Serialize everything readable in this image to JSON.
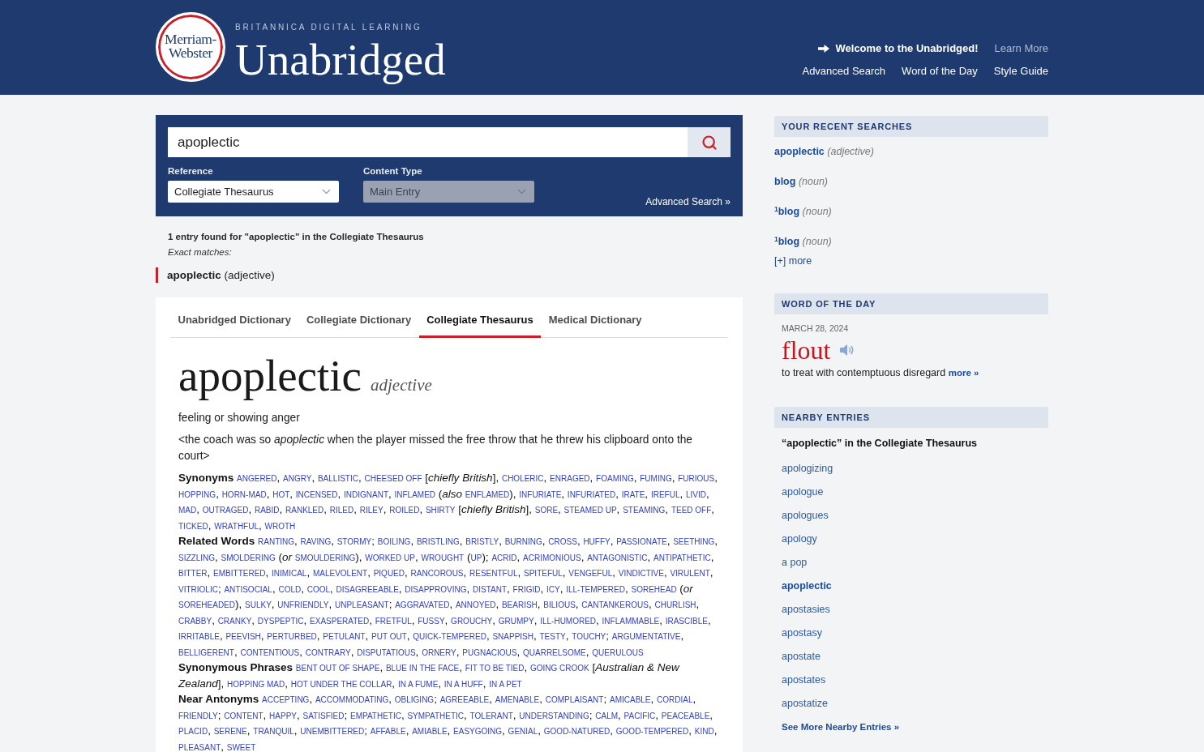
{
  "header": {
    "logo": "Merriam-Webster",
    "tagline": "BRITANNICA DIGITAL LEARNING",
    "title": "Unabridged",
    "welcome": "Welcome to the Unabridged!",
    "learn_more": "Learn More",
    "nav": [
      "Advanced Search",
      "Word of the Day",
      "Style Guide"
    ]
  },
  "search": {
    "value": "apoplectic",
    "selects": [
      {
        "label": "Reference",
        "value": "Collegiate Thesaurus",
        "disabled": false
      },
      {
        "label": "Content Type",
        "value": "Main Entry",
        "disabled": true
      }
    ],
    "advanced_link": "Advanced Search »"
  },
  "results": {
    "summary": "1 entry found for \"apoplectic\" in the Collegiate Thesaurus",
    "exact_label": "Exact matches:",
    "matches": [
      "**apoplectic** (adjective)"
    ]
  },
  "tabs": [
    {
      "label": "Unabridged Dictionary",
      "selected": false
    },
    {
      "label": "Collegiate Dictionary",
      "selected": false
    },
    {
      "label": "Collegiate Thesaurus",
      "selected": true
    },
    {
      "label": "Medical Dictionary",
      "selected": false
    }
  ],
  "entry": {
    "headword": "apoplectic",
    "pos": "adjective",
    "definition": "feeling or showing anger",
    "example": "<the coach was so *apoplectic* when the player missed the free throw that he threw his clipboard onto the court>",
    "word_groups": [
      {
        "label": "Synonyms",
        "items": [
          {
            "kind": "link",
            "text": "ANGERED",
            "sep": ", "
          },
          {
            "kind": "link",
            "text": "ANGRY",
            "sep": ", "
          },
          {
            "kind": "link",
            "text": "BALLISTIC",
            "sep": ", "
          },
          {
            "kind": "link",
            "text": "CHEESED OFF",
            "sep": " ["
          },
          {
            "kind": "note",
            "text": "chiefly British",
            "sep": "], "
          },
          {
            "kind": "link",
            "text": "CHOLERIC",
            "sep": ", "
          },
          {
            "kind": "link",
            "text": "ENRAGED",
            "sep": ", "
          },
          {
            "kind": "link",
            "text": "FOAMING",
            "sep": ", "
          },
          {
            "kind": "link",
            "text": "FUMING",
            "sep": ", "
          },
          {
            "kind": "link",
            "text": "FURIOUS",
            "sep": ", "
          },
          {
            "kind": "link",
            "text": "HOPPING",
            "sep": ", "
          },
          {
            "kind": "link",
            "text": "HORN-MAD",
            "sep": ", "
          },
          {
            "kind": "link",
            "text": "HOT",
            "sep": ", "
          },
          {
            "kind": "link",
            "text": "INCENSED",
            "sep": ", "
          },
          {
            "kind": "link",
            "text": "INDIGNANT",
            "sep": ", "
          },
          {
            "kind": "link",
            "text": "INFLAMED",
            "sep": " ("
          },
          {
            "kind": "note",
            "text": "also"
          },
          {
            "kind": "link",
            "text": "ENFLAMED",
            "sep": "), "
          },
          {
            "kind": "link",
            "text": "INFURIATE",
            "sep": ", "
          },
          {
            "kind": "link",
            "text": "INFURIATED",
            "sep": ", "
          },
          {
            "kind": "link",
            "text": "IRATE",
            "sep": ", "
          },
          {
            "kind": "link",
            "text": "IREFUL",
            "sep": ", "
          },
          {
            "kind": "link",
            "text": "LIVID",
            "sep": ", "
          },
          {
            "kind": "link",
            "text": "MAD",
            "sep": ", "
          },
          {
            "kind": "link",
            "text": "OUTRAGED",
            "sep": ", "
          },
          {
            "kind": "link",
            "text": "RABID",
            "sep": ", "
          },
          {
            "kind": "link",
            "text": "RANKLED",
            "sep": ", "
          },
          {
            "kind": "link",
            "text": "RILED",
            "sep": ", "
          },
          {
            "kind": "link",
            "text": "RILEY",
            "sep": ", "
          },
          {
            "kind": "link",
            "text": "ROILED",
            "sep": ", "
          },
          {
            "kind": "link",
            "text": "SHIRTY",
            "sep": " ["
          },
          {
            "kind": "note",
            "text": "chiefly British",
            "sep": "], "
          },
          {
            "kind": "link",
            "text": "SORE",
            "sep": ", "
          },
          {
            "kind": "link",
            "text": "STEAMED UP",
            "sep": ", "
          },
          {
            "kind": "link",
            "text": "STEAMING",
            "sep": ", "
          },
          {
            "kind": "link",
            "text": "TEED OFF",
            "sep": ", "
          },
          {
            "kind": "link",
            "text": "TICKED",
            "sep": ", "
          },
          {
            "kind": "link",
            "text": "WRATHFUL",
            "sep": ", "
          },
          {
            "kind": "link",
            "text": "WROTH"
          }
        ]
      },
      {
        "label": "Related Words",
        "items": [
          {
            "kind": "link",
            "text": "RANTING",
            "sep": ", "
          },
          {
            "kind": "link",
            "text": "RAVING",
            "sep": ", "
          },
          {
            "kind": "link",
            "text": "STORMY",
            "sep": "; "
          },
          {
            "kind": "link",
            "text": "BOILING",
            "sep": ", "
          },
          {
            "kind": "link",
            "text": "BRISTLING",
            "sep": ", "
          },
          {
            "kind": "link",
            "text": "BRISTLY",
            "sep": ", "
          },
          {
            "kind": "link",
            "text": "BURNING",
            "sep": ", "
          },
          {
            "kind": "link",
            "text": "CROSS",
            "sep": ", "
          },
          {
            "kind": "link",
            "text": "HUFFY",
            "sep": ", "
          },
          {
            "kind": "link",
            "text": "PASSIONATE",
            "sep": ", "
          },
          {
            "kind": "link",
            "text": "SEETHING",
            "sep": ", "
          },
          {
            "kind": "link",
            "text": "SIZZLING",
            "sep": ", "
          },
          {
            "kind": "link",
            "text": "SMOLDERING",
            "sep": " ("
          },
          {
            "kind": "note",
            "text": "or"
          },
          {
            "kind": "link",
            "text": "SMOULDERING",
            "sep": "), "
          },
          {
            "kind": "link",
            "text": "WORKED UP",
            "sep": ", "
          },
          {
            "kind": "link",
            "text": "WROUGHT",
            "sep": " ("
          },
          {
            "kind": "link",
            "text": "UP",
            "sep": "); "
          },
          {
            "kind": "link",
            "text": "ACRID",
            "sep": ", "
          },
          {
            "kind": "link",
            "text": "ACRIMONIOUS",
            "sep": ", "
          },
          {
            "kind": "link",
            "text": "ANTAGONISTIC",
            "sep": ", "
          },
          {
            "kind": "link",
            "text": "ANTIPATHETIC",
            "sep": ", "
          },
          {
            "kind": "link",
            "text": "BITTER",
            "sep": ", "
          },
          {
            "kind": "link",
            "text": "EMBITTERED",
            "sep": ", "
          },
          {
            "kind": "link",
            "text": "INIMICAL",
            "sep": ", "
          },
          {
            "kind": "link",
            "text": "MALEVOLENT",
            "sep": ", "
          },
          {
            "kind": "link",
            "text": "PIQUED",
            "sep": ", "
          },
          {
            "kind": "link",
            "text": "RANCOROUS",
            "sep": ", "
          },
          {
            "kind": "link",
            "text": "RESENTFUL",
            "sep": ", "
          },
          {
            "kind": "link",
            "text": "SPITEFUL",
            "sep": ", "
          },
          {
            "kind": "link",
            "text": "VENGEFUL",
            "sep": ", "
          },
          {
            "kind": "link",
            "text": "VINDICTIVE",
            "sep": ", "
          },
          {
            "kind": "link",
            "text": "VIRULENT",
            "sep": ", "
          },
          {
            "kind": "link",
            "text": "VITRIOLIC",
            "sep": "; "
          },
          {
            "kind": "link",
            "text": "ANTISOCIAL",
            "sep": ", "
          },
          {
            "kind": "link",
            "text": "COLD",
            "sep": ", "
          },
          {
            "kind": "link",
            "text": "COOL",
            "sep": ", "
          },
          {
            "kind": "link",
            "text": "DISAGREEABLE",
            "sep": ", "
          },
          {
            "kind": "link",
            "text": "DISAPPROVING",
            "sep": ", "
          },
          {
            "kind": "link",
            "text": "DISTANT",
            "sep": ", "
          },
          {
            "kind": "link",
            "text": "FRIGID",
            "sep": ", "
          },
          {
            "kind": "link",
            "text": "ICY",
            "sep": ", "
          },
          {
            "kind": "link",
            "text": "ILL-TEMPERED",
            "sep": ", "
          },
          {
            "kind": "link",
            "text": "SOREHEAD",
            "sep": " ("
          },
          {
            "kind": "note",
            "text": "or"
          },
          {
            "kind": "link",
            "text": "SOREHEADED",
            "sep": "), "
          },
          {
            "kind": "link",
            "text": "SULKY",
            "sep": ", "
          },
          {
            "kind": "link",
            "text": "UNFRIENDLY",
            "sep": ", "
          },
          {
            "kind": "link",
            "text": "UNPLEASANT",
            "sep": "; "
          },
          {
            "kind": "link",
            "text": "AGGRAVATED",
            "sep": ", "
          },
          {
            "kind": "link",
            "text": "ANNOYED",
            "sep": ", "
          },
          {
            "kind": "link",
            "text": "BEARISH",
            "sep": ", "
          },
          {
            "kind": "link",
            "text": "BILIOUS",
            "sep": ", "
          },
          {
            "kind": "link",
            "text": "CANTANKEROUS",
            "sep": ", "
          },
          {
            "kind": "link",
            "text": "CHURLISH",
            "sep": ", "
          },
          {
            "kind": "link",
            "text": "CRABBY",
            "sep": ", "
          },
          {
            "kind": "link",
            "text": "CRANKY",
            "sep": ", "
          },
          {
            "kind": "link",
            "text": "DYSPEPTIC",
            "sep": ", "
          },
          {
            "kind": "link",
            "text": "EXASPERATED",
            "sep": ", "
          },
          {
            "kind": "link",
            "text": "FRETFUL",
            "sep": ", "
          },
          {
            "kind": "link",
            "text": "FUSSY",
            "sep": ", "
          },
          {
            "kind": "link",
            "text": "GROUCHY",
            "sep": ", "
          },
          {
            "kind": "link",
            "text": "GRUMPY",
            "sep": ", "
          },
          {
            "kind": "link",
            "text": "ILL-HUMORED",
            "sep": ", "
          },
          {
            "kind": "link",
            "text": "INFLAMMABLE",
            "sep": ", "
          },
          {
            "kind": "link",
            "text": "IRASCIBLE",
            "sep": ", "
          },
          {
            "kind": "link",
            "text": "IRRITABLE",
            "sep": ", "
          },
          {
            "kind": "link",
            "text": "PEEVISH",
            "sep": ", "
          },
          {
            "kind": "link",
            "text": "PERTURBED",
            "sep": ", "
          },
          {
            "kind": "link",
            "text": "PETULANT",
            "sep": ", "
          },
          {
            "kind": "link",
            "text": "PUT OUT",
            "sep": ", "
          },
          {
            "kind": "link",
            "text": "QUICK-TEMPERED",
            "sep": ", "
          },
          {
            "kind": "link",
            "text": "SNAPPISH",
            "sep": ", "
          },
          {
            "kind": "link",
            "text": "TESTY",
            "sep": ", "
          },
          {
            "kind": "link",
            "text": "TOUCHY",
            "sep": "; "
          },
          {
            "kind": "link",
            "text": "ARGUMENTATIVE",
            "sep": ", "
          },
          {
            "kind": "link",
            "text": "BELLIGERENT",
            "sep": ", "
          },
          {
            "kind": "link",
            "text": "CONTENTIOUS",
            "sep": ", "
          },
          {
            "kind": "link",
            "text": "CONTRARY",
            "sep": ", "
          },
          {
            "kind": "link",
            "text": "DISPUTATIOUS",
            "sep": ", "
          },
          {
            "kind": "link",
            "text": "ORNERY",
            "sep": ", "
          },
          {
            "kind": "link",
            "text": "PUGNACIOUS",
            "sep": ", "
          },
          {
            "kind": "link",
            "text": "QUARRELSOME",
            "sep": ", "
          },
          {
            "kind": "link",
            "text": "QUERULOUS"
          }
        ]
      },
      {
        "label": "Synonymous Phrases",
        "items": [
          {
            "kind": "link",
            "text": "BENT OUT OF SHAPE",
            "sep": ", "
          },
          {
            "kind": "link",
            "text": "BLUE IN THE FACE",
            "sep": ", "
          },
          {
            "kind": "link",
            "text": "FIT TO BE TIED",
            "sep": ", "
          },
          {
            "kind": "link",
            "text": "GOING CROOK",
            "sep": " ["
          },
          {
            "kind": "note",
            "text": "Australian & New Zealand",
            "sep": "], "
          },
          {
            "kind": "link",
            "text": "HOPPING MAD",
            "sep": ", "
          },
          {
            "kind": "link",
            "text": "HOT UNDER THE COLLAR",
            "sep": ", "
          },
          {
            "kind": "link",
            "text": "IN A FUME",
            "sep": ", "
          },
          {
            "kind": "link",
            "text": "IN A HUFF",
            "sep": ", "
          },
          {
            "kind": "link",
            "text": "IN A PET"
          }
        ]
      },
      {
        "label": "Near Antonyms",
        "items": [
          {
            "kind": "link",
            "text": "ACCEPTING",
            "sep": ", "
          },
          {
            "kind": "link",
            "text": "ACCOMMODATING",
            "sep": ", "
          },
          {
            "kind": "link",
            "text": "OBLIGING",
            "sep": "; "
          },
          {
            "kind": "link",
            "text": "AGREEABLE",
            "sep": ", "
          },
          {
            "kind": "link",
            "text": "AMENABLE",
            "sep": ", "
          },
          {
            "kind": "link",
            "text": "COMPLAISANT",
            "sep": "; "
          },
          {
            "kind": "link",
            "text": "AMICABLE",
            "sep": ", "
          },
          {
            "kind": "link",
            "text": "CORDIAL",
            "sep": ", "
          },
          {
            "kind": "link",
            "text": "FRIENDLY",
            "sep": "; "
          },
          {
            "kind": "link",
            "text": "CONTENT",
            "sep": ", "
          },
          {
            "kind": "link",
            "text": "HAPPY",
            "sep": ", "
          },
          {
            "kind": "link",
            "text": "SATISFIED",
            "sep": "; "
          },
          {
            "kind": "link",
            "text": "EMPATHETIC",
            "sep": ", "
          },
          {
            "kind": "link",
            "text": "SYMPATHETIC",
            "sep": ", "
          },
          {
            "kind": "link",
            "text": "TOLERANT",
            "sep": ", "
          },
          {
            "kind": "link",
            "text": "UNDERSTANDING",
            "sep": "; "
          },
          {
            "kind": "link",
            "text": "CALM",
            "sep": ", "
          },
          {
            "kind": "link",
            "text": "PACIFIC",
            "sep": ", "
          },
          {
            "kind": "link",
            "text": "PEACEABLE",
            "sep": ", "
          },
          {
            "kind": "link",
            "text": "PLACID",
            "sep": ", "
          },
          {
            "kind": "link",
            "text": "SERENE",
            "sep": ", "
          },
          {
            "kind": "link",
            "text": "TRANQUIL",
            "sep": ", "
          },
          {
            "kind": "link",
            "text": "UNEMBITTERED",
            "sep": "; "
          },
          {
            "kind": "link",
            "text": "AFFABLE",
            "sep": ", "
          },
          {
            "kind": "link",
            "text": "AMIABLE",
            "sep": ", "
          },
          {
            "kind": "link",
            "text": "EASYGOING",
            "sep": ", "
          },
          {
            "kind": "link",
            "text": "GENIAL",
            "sep": ", "
          },
          {
            "kind": "link",
            "text": "GOOD-NATURED",
            "sep": ", "
          },
          {
            "kind": "link",
            "text": "GOOD-TEMPERED",
            "sep": ", "
          },
          {
            "kind": "link",
            "text": "KIND",
            "sep": ", "
          },
          {
            "kind": "link",
            "text": "PLEASANT",
            "sep": ", "
          },
          {
            "kind": "link",
            "text": "SWEET"
          }
        ]
      }
    ]
  },
  "sidebar": {
    "recent": {
      "title": "YOUR RECENT SEARCHES",
      "items": [
        {
          "word": "apoplectic",
          "pos": "(adjective)"
        },
        {
          "word": "blog",
          "pos": "(noun)"
        },
        {
          "word": "$^{1}$blog",
          "pos": "(noun)"
        },
        {
          "word": "$^{1}$blog",
          "pos": "(noun)"
        }
      ],
      "more": "[+] more"
    },
    "word_of_day": {
      "title": "WORD OF THE DAY",
      "date": "MARCH 28, 2024",
      "word": "flout",
      "definition": "to treat with contemptuous disregard",
      "more": "more »"
    },
    "nearby": {
      "title": "NEARBY ENTRIES",
      "subtitle": "“apoplectic” in the Collegiate Thesaurus",
      "items": [
        {
          "word": "apologizing",
          "selected": false
        },
        {
          "word": "apologue",
          "selected": false
        },
        {
          "word": "apologues",
          "selected": false
        },
        {
          "word": "apology",
          "selected": false
        },
        {
          "word": "a pop",
          "selected": false
        },
        {
          "word": "apoplectic",
          "selected": true
        },
        {
          "word": "apostasies",
          "selected": false
        },
        {
          "word": "apostasy",
          "selected": false
        },
        {
          "word": "apostate",
          "selected": false
        },
        {
          "word": "apostates",
          "selected": false
        },
        {
          "word": "apostatize",
          "selected": false
        }
      ],
      "see_more": "See More Nearby Entries »"
    }
  }
}
